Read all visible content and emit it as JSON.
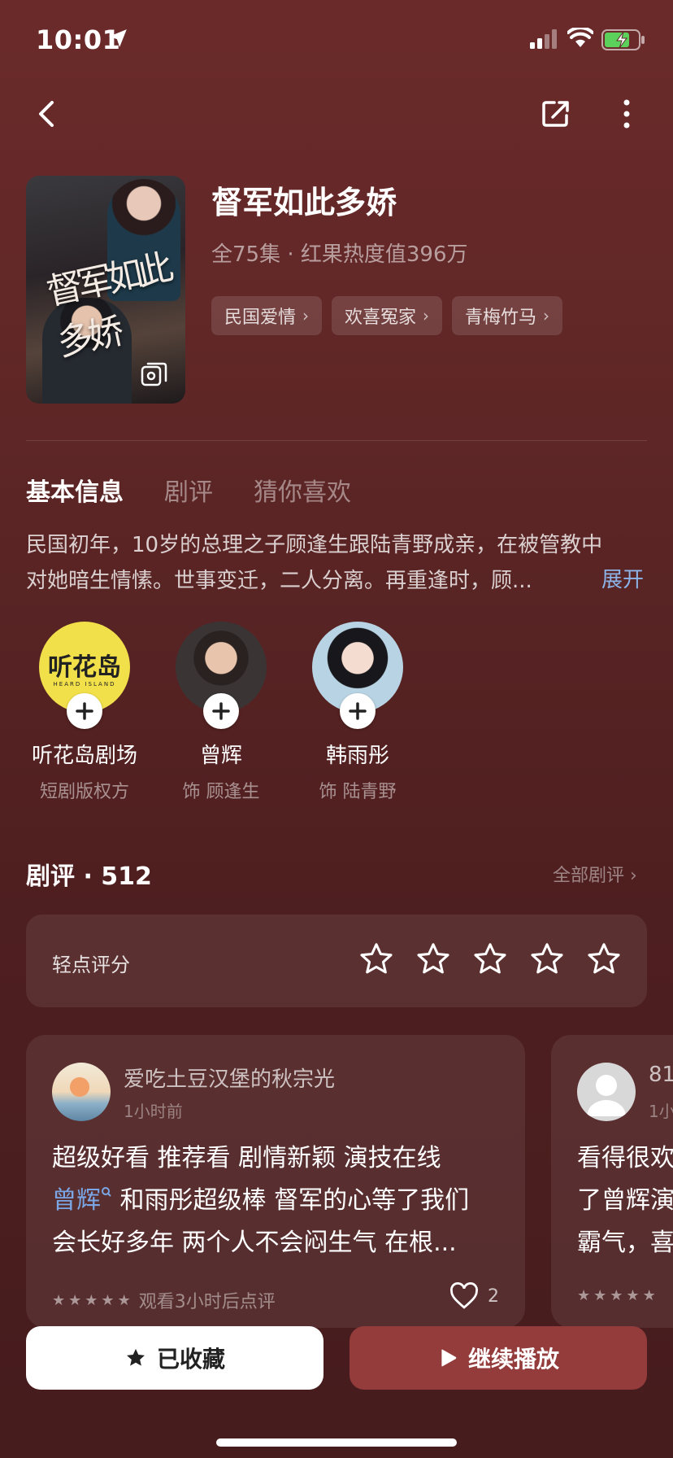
{
  "status_bar": {
    "time": "10:01"
  },
  "drama": {
    "title": "督军如此多娇",
    "meta": "全75集 · 红果热度值396万",
    "poster_text": "督军如此多娇",
    "tags": [
      "民国爱情",
      "欢喜冤家",
      "青梅竹马"
    ]
  },
  "tabs": [
    {
      "label": "基本信息",
      "active": true
    },
    {
      "label": "剧评",
      "active": false
    },
    {
      "label": "猜你喜欢",
      "active": false
    }
  ],
  "synopsis": {
    "line1": "民国初年，10岁的总理之子顾逢生跟陆青野成亲，在被管教中",
    "line2": "对她暗生情愫。世事变迁，二人分离。再重逢时，顾...",
    "expand_label": "展开"
  },
  "cast": [
    {
      "name": "听花岛剧场",
      "role": "短剧版权方",
      "avatar_text": "听花岛",
      "avatar_sub": "HEARD ISLAND"
    },
    {
      "name": "曾辉",
      "role": "饰 顾逢生"
    },
    {
      "name": "韩雨彤",
      "role": "饰 陆青野"
    }
  ],
  "reviews": {
    "header": "剧评 · 512",
    "all_link": "全部剧评 ›",
    "rating_label": "轻点评分",
    "rating_stars": 0,
    "items": [
      {
        "user": "爱吃土豆汉堡的秋宗光",
        "time": "1小时前",
        "line1": "超级好看 推荐看 剧情新颖 演技在线",
        "mention": "曾辉",
        "line2_rest": " 和雨彤超级棒 督军的心等了我们",
        "line3": "会长好多年 两个人不会闷生气 在根...",
        "note": "观看3小时后点评",
        "likes": "2",
        "stars": 5
      },
      {
        "user": "81",
        "time": "1小",
        "line1": "看得很欢",
        "line2": "了曾辉演",
        "line3": "霸气，喜"
      }
    ]
  },
  "bottom": {
    "collect_label": "已收藏",
    "play_label": "继续播放"
  },
  "colors": {
    "background": "#5e2626",
    "accent_button": "#943c3c",
    "link_blue": "#8cb4e8",
    "brand_yellow": "#f2e04a"
  }
}
